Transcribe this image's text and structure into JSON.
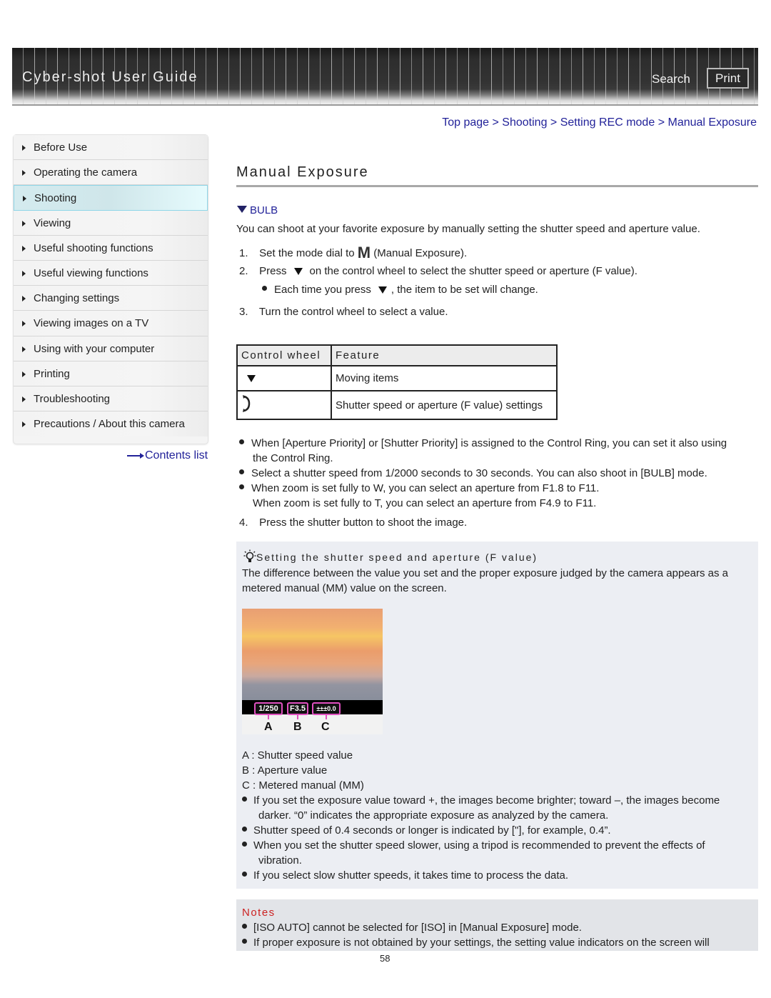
{
  "header": {
    "title": "Cyber-shot User Guide",
    "search_label": "Search",
    "print_label": "Print"
  },
  "breadcrumb": {
    "items": [
      "Top page",
      "Shooting",
      "Setting REC mode",
      "Manual Exposure"
    ],
    "separator": ">"
  },
  "sidebar": {
    "items": [
      {
        "label": "Before Use",
        "active": false
      },
      {
        "label": "Operating the camera",
        "active": false
      },
      {
        "label": "Shooting",
        "active": true
      },
      {
        "label": "Viewing",
        "active": false
      },
      {
        "label": "Useful shooting functions",
        "active": false
      },
      {
        "label": "Useful viewing functions",
        "active": false
      },
      {
        "label": "Changing settings",
        "active": false
      },
      {
        "label": "Viewing images on a TV",
        "active": false
      },
      {
        "label": "Using with your computer",
        "active": false
      },
      {
        "label": "Printing",
        "active": false
      },
      {
        "label": "Troubleshooting",
        "active": false
      },
      {
        "label": "Precautions / About this camera",
        "active": false
      }
    ],
    "contents_list_label": "Contents list"
  },
  "main": {
    "title": "Manual Exposure",
    "bulb_link": "BULB",
    "intro": "You can shoot at your favorite exposure by manually setting the shutter speed and aperture value.",
    "steps": {
      "s1_num": "1.",
      "s1_pre": "Set the mode dial to",
      "s1_icon": "M",
      "s1_post": "(Manual Exposure).",
      "s2_num": "2.",
      "s2_pre": "Press",
      "s2_post": "on the control wheel to select the shutter speed or aperture (F value).",
      "s2_sub_pre": "Each time you press",
      "s2_sub_post": ", the item to be set will change.",
      "s3_num": "3.",
      "s3": "Turn the control wheel to select a value.",
      "s4_num": "4.",
      "s4": "Press the shutter button to shoot the image."
    },
    "table": {
      "headers": [
        "Control wheel",
        "Feature"
      ],
      "rows": [
        {
          "icon": "down-triangle-icon",
          "feature": "Moving items"
        },
        {
          "icon": "rotate-wheel-icon",
          "feature": "Shutter speed or aperture (F value) settings"
        }
      ]
    },
    "bullets": [
      "When [Aperture Priority] or [Shutter Priority] is assigned to the Control Ring, you can set it also using",
      "the Control Ring.",
      "Select a shutter speed from 1/2000 seconds to 30 seconds. You can also shoot in [BULB] mode.",
      "When zoom is set fully to W, you can select an aperture from F1.8 to F11.",
      "When zoom is set fully to T, you can select an aperture from F4.9 to F11."
    ]
  },
  "tip": {
    "title": "Setting the shutter speed and aperture (F value)",
    "text_line1": "The difference between the value you set and the proper exposure judged by the camera appears as a",
    "text_line2": "metered manual (MM) value on the screen.",
    "screen": {
      "shutter": "1/250",
      "aperture": "F3.5",
      "mm": "±±±0.0",
      "labels": [
        "A",
        "B",
        "C"
      ]
    },
    "legend": [
      "A : Shutter speed value",
      "B : Aperture value",
      "C : Metered manual (MM)"
    ],
    "bullets": [
      "If you set the exposure value toward +, the images become brighter; toward –, the images become",
      "darker. “0” indicates the appropriate exposure as analyzed by the camera.",
      "Shutter speed of 0.4 seconds or longer is indicated by [\"], for example, 0.4”.",
      "When you set the shutter speed slower, using a tripod is recommended to prevent the effects of",
      "vibration.",
      "If you select slow shutter speeds, it takes time to process the data."
    ]
  },
  "notes": {
    "title": "Notes",
    "items": [
      "[ISO AUTO] cannot be selected for [ISO] in [Manual Exposure] mode.",
      "If proper exposure is not obtained by your settings, the setting value indicators on the screen will"
    ]
  },
  "page_number": "58"
}
